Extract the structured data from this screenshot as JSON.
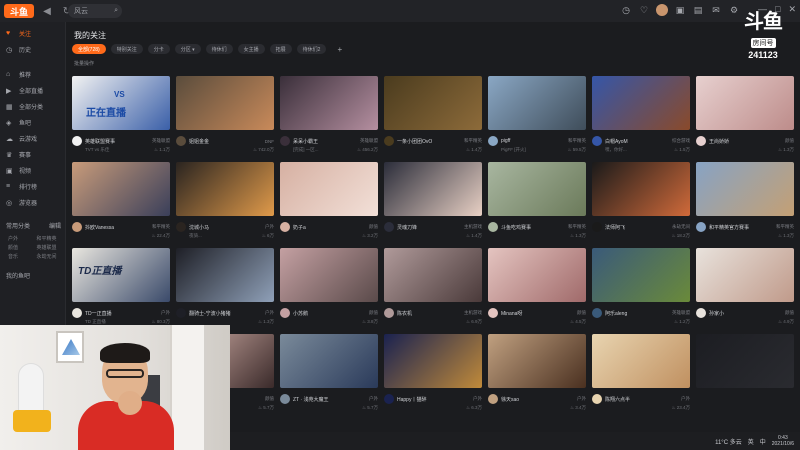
{
  "app": {
    "logo_text": "斗鱼"
  },
  "search": {
    "value": "风云",
    "icon": "search-icon"
  },
  "watermark": {
    "logo": "斗鱼",
    "label": "房间号",
    "room_number": "241123"
  },
  "colors": {
    "accent": "#ff6a1a",
    "background": "#1b1c1f",
    "sidebar": "#1f2024"
  },
  "sidebar": {
    "items": [
      {
        "label": "关注",
        "icon": "heart-icon"
      },
      {
        "label": "历史",
        "icon": "history-icon"
      },
      {
        "label": "推荐",
        "icon": "home-icon"
      },
      {
        "label": "全部直播",
        "icon": "play-icon"
      },
      {
        "label": "全部分类",
        "icon": "grid-icon"
      },
      {
        "label": "鱼吧",
        "icon": "fish-icon"
      },
      {
        "label": "云游戏",
        "icon": "cloud-icon"
      },
      {
        "label": "赛事",
        "icon": "trophy-icon"
      },
      {
        "label": "视频",
        "icon": "video-icon"
      },
      {
        "label": "排行榜",
        "icon": "rank-icon"
      },
      {
        "label": "游览器",
        "icon": "browser-icon"
      }
    ],
    "section_common": {
      "title": "常用分类",
      "action": "编辑"
    },
    "common_categories": [
      "户外",
      "和平精英",
      "颜值",
      "英雄联盟",
      "音乐",
      "永劫无间"
    ],
    "section_mine": {
      "title": "我的鱼吧"
    }
  },
  "page": {
    "title": "我的关注",
    "filters": [
      {
        "label": "全部(728)",
        "active": true
      },
      {
        "label": "特别关注",
        "active": false
      },
      {
        "label": "分卡",
        "active": false
      },
      {
        "label": "分区 ▾",
        "active": false
      },
      {
        "label": "待休们",
        "active": false
      },
      {
        "label": "女主播",
        "active": false
      },
      {
        "label": "拓展",
        "active": false
      },
      {
        "label": "待休们2",
        "active": false
      },
      {
        "label": "+",
        "active": false
      }
    ],
    "batch_label": "批量操作"
  },
  "cards": [
    {
      "name": "英雄联盟赛事",
      "category": "英雄联盟",
      "sub": "TVT vs 乐佳",
      "hot": "1.1万"
    },
    {
      "name": "姐姐金金",
      "category": "DNF",
      "sub": "",
      "hot": "742.0万"
    },
    {
      "name": "呆呆小霸王",
      "category": "英雄联盟",
      "sub": "[完成] 一区...",
      "hot": "456.2万"
    },
    {
      "name": "一条小团团OvO",
      "category": "和平精英",
      "sub": "",
      "hot": "1.4万"
    },
    {
      "name": "pigff",
      "category": "和平精英",
      "sub": "PigFF [开火]",
      "hot": "59.5万"
    },
    {
      "name": "白帽AyoM",
      "category": "综合游戏",
      "sub": "嘿，你好...",
      "hot": "1.5万"
    },
    {
      "name": "王尚娇娇",
      "category": "颜值",
      "sub": "",
      "hot": "1.3万"
    },
    {
      "name": "抖欧Vanessa",
      "category": "和平精英",
      "sub": "",
      "hot": "22.4万"
    },
    {
      "name": "沈城小马",
      "category": "户外",
      "sub": "夜骑...",
      "hot": "6万"
    },
    {
      "name": "奶子a",
      "category": "颜值",
      "sub": "",
      "hot": "3.2万"
    },
    {
      "name": "灵魂刀锋",
      "category": "主机游戏",
      "sub": "",
      "hot": "1.4万"
    },
    {
      "name": "斗鱼吃鸡赛事",
      "category": "和平精英",
      "sub": "",
      "hot": "1.3万"
    },
    {
      "name": "法师阿飞",
      "category": "永劫无间",
      "sub": "",
      "hot": "18.2万"
    },
    {
      "name": "和平精英官方赛事",
      "category": "和平精英",
      "sub": "",
      "hot": "1.3万"
    },
    {
      "name": "TD一正直播",
      "category": "户外",
      "sub": "TD 正直播",
      "hot": "80.3万"
    },
    {
      "name": "翻骑士-宁波小猪猪",
      "category": "户外",
      "sub": "",
      "hot": "1.3万"
    },
    {
      "name": "小苏鹅",
      "category": "颜值",
      "sub": "",
      "hot": "3.8万"
    },
    {
      "name": "陈农机",
      "category": "主机游戏",
      "sub": "",
      "hot": "6.9万"
    },
    {
      "name": "Minana呀",
      "category": "颜值",
      "sub": "",
      "hot": "4.5万"
    },
    {
      "name": "阿乐aleng",
      "category": "英雄联盟",
      "sub": "",
      "hot": "1.2万"
    },
    {
      "name": "孙家小",
      "category": "颜值",
      "sub": "",
      "hot": "4.9万"
    },
    {
      "name": "",
      "category": "",
      "sub": "",
      "hot": ""
    },
    {
      "name": "大漂love",
      "category": "颜值",
      "sub": "",
      "hot": "5.7万"
    },
    {
      "name": "ZT · 浅苑大魔王",
      "category": "户外",
      "sub": "",
      "hot": "5.7万"
    },
    {
      "name": "Happy丨猫醉",
      "category": "户外",
      "sub": "",
      "hot": "6.3万"
    },
    {
      "name": "徐天sao",
      "category": "户外",
      "sub": "",
      "hot": "3.4万"
    },
    {
      "name": "陈翔六点半",
      "category": "户外",
      "sub": "",
      "hot": "23.4万"
    },
    {
      "name": "",
      "category": "",
      "sub": "",
      "hot": ""
    }
  ],
  "featured_badge": {
    "text": "正在直播",
    "score": "VS"
  },
  "td_badge": "TD正直播",
  "taskbar": {
    "weather": "11°C 多云",
    "time": "0:43",
    "date": "2021/10/6",
    "lang": "中",
    "lang2": "英"
  }
}
